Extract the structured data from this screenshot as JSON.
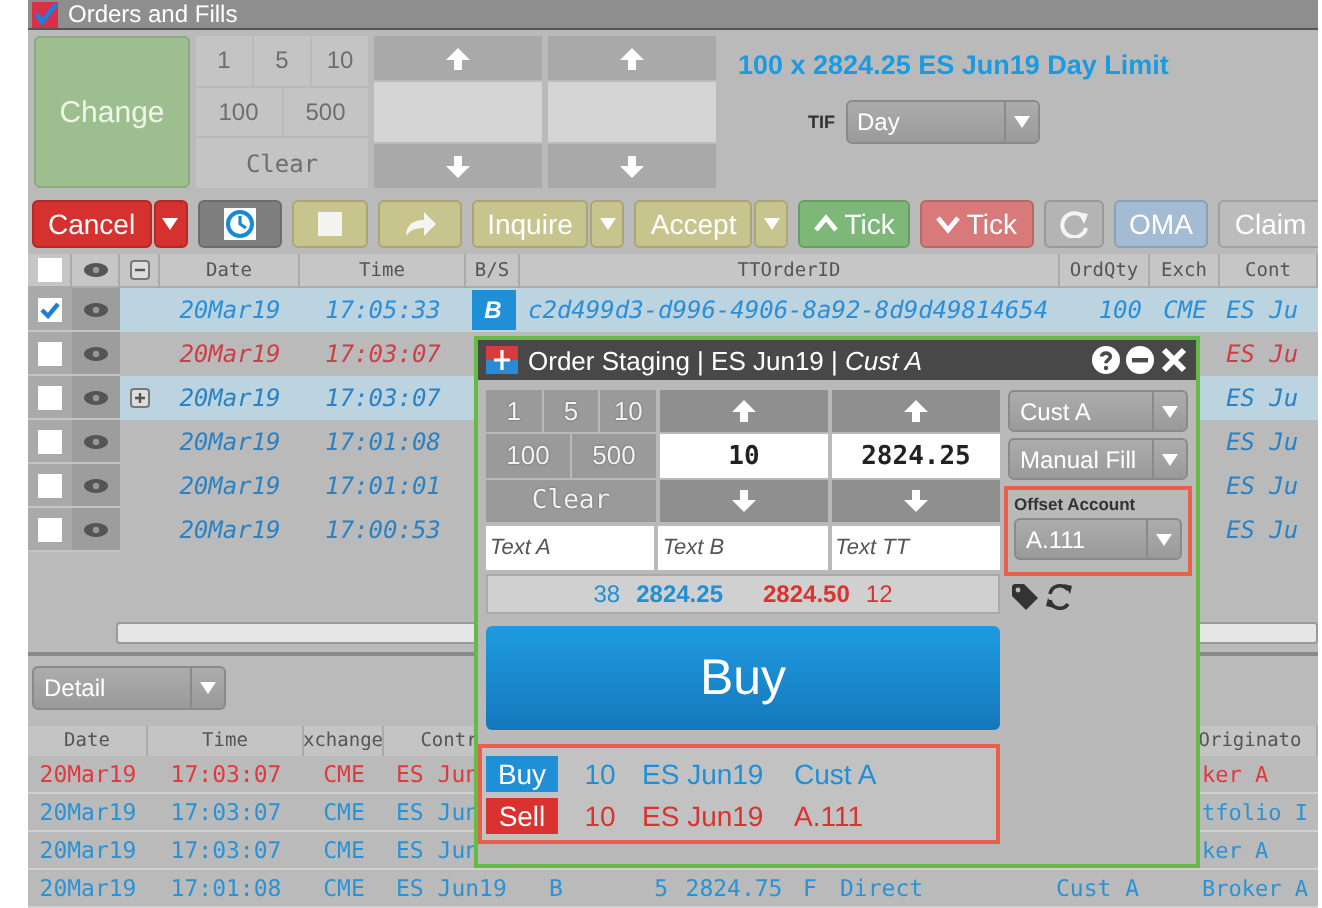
{
  "panel": {
    "title": "Orders and Fills",
    "checked": true
  },
  "order_entry": {
    "change_button": "Change",
    "quantity_buttons": [
      "1",
      "5",
      "10",
      "100",
      "500"
    ],
    "clear_button": "Clear",
    "description": "100 x 2824.25 ES Jun19 Day Limit",
    "tif": {
      "label": "TIF",
      "value": "Day"
    }
  },
  "toolbar": [
    {
      "kind": "button",
      "label": "Cancel",
      "color": "#d4312f",
      "caret": true
    },
    {
      "kind": "history",
      "color": "#7f7f7f"
    },
    {
      "kind": "stop",
      "color": "#c8c48e"
    },
    {
      "kind": "redo",
      "color": "#c8c48e"
    },
    {
      "kind": "button",
      "label": "Inquire",
      "color": "#c8c48e",
      "caret": true
    },
    {
      "kind": "button",
      "label": "Accept",
      "color": "#c8c48e",
      "caret": true
    },
    {
      "kind": "tick-up",
      "label": "Tick",
      "color": "#7db878"
    },
    {
      "kind": "tick-down",
      "label": "Tick",
      "color": "#d87a7a"
    },
    {
      "kind": "refresh",
      "color": "#b4b4b4"
    },
    {
      "kind": "button",
      "label": "OMA",
      "color": "#a4bbd4"
    },
    {
      "kind": "button",
      "label": "Claim",
      "color": "#bcbcbc"
    }
  ],
  "orders_table": {
    "select_all_checked": false,
    "columns": [
      "Date",
      "Time",
      "B/S",
      "TTOrderID",
      "OrdQty",
      "Exch",
      "Cont"
    ],
    "rows": [
      {
        "checked": true,
        "selected": true,
        "expandable": false,
        "color": "#2a8fd8",
        "date": "20Mar19",
        "time": "17:05:33",
        "side": "B",
        "order_id": "c2d499d3-d996-4906-8a92-8d9d49814654",
        "qty": "100",
        "exchange": "CME",
        "contract": "ES Ju"
      },
      {
        "checked": false,
        "selected": false,
        "expandable": false,
        "color": "#cc3f46",
        "date": "20Mar19",
        "time": "17:03:07",
        "contract": "ES Ju"
      },
      {
        "checked": false,
        "selected": true,
        "expandable": true,
        "color": "#2a82c4",
        "date": "20Mar19",
        "time": "17:03:07",
        "contract": "ES Ju"
      },
      {
        "checked": false,
        "selected": false,
        "expandable": false,
        "color": "#2a82c4",
        "date": "20Mar19",
        "time": "17:01:08",
        "contract": "ES Ju"
      },
      {
        "checked": false,
        "selected": false,
        "expandable": false,
        "color": "#2a82c4",
        "date": "20Mar19",
        "time": "17:01:01",
        "contract": "ES Ju"
      },
      {
        "checked": false,
        "selected": false,
        "expandable": false,
        "color": "#2a82c4",
        "date": "20Mar19",
        "time": "17:00:53",
        "contract": "ES Ju"
      }
    ]
  },
  "detail_view": {
    "value": "Detail"
  },
  "fills_table": {
    "columns": [
      "Date",
      "Time",
      "xchange",
      "Contr",
      "Originato"
    ],
    "rows": [
      {
        "color": "#e0393e",
        "date": "20Mar19",
        "time": "17:03:07",
        "exchange": "CME",
        "contract": "ES Jun",
        "originator": "ker A"
      },
      {
        "color": "#2a93d5",
        "date": "20Mar19",
        "time": "17:03:07",
        "exchange": "CME",
        "contract": "ES Jun",
        "originator": "tfolio I"
      },
      {
        "color": "#2a93d5",
        "date": "20Mar19",
        "time": "17:03:07",
        "exchange": "CME",
        "contract": "ES Jun",
        "originator": "ker A"
      },
      {
        "color": "#2a93d5",
        "date": "20Mar19",
        "time": "17:01:08",
        "exchange": "CME",
        "contract": "ES Jun19",
        "side": "B",
        "qty": "5",
        "price": "2824.75",
        "type": "F",
        "route": "Direct",
        "account": "Cust A",
        "originator": "Broker A"
      }
    ]
  },
  "order_staging": {
    "title": "Order Staging | ES Jun19 | *Cust A*",
    "quantity_buttons": [
      "1",
      "5",
      "10",
      "100",
      "500"
    ],
    "clear_button": "Clear",
    "quantity": "10",
    "price": "2824.25",
    "text_fields": [
      {
        "placeholder": "Text A"
      },
      {
        "placeholder": "Text B"
      },
      {
        "placeholder": "Text TT"
      }
    ],
    "market": {
      "bid_qty": "38",
      "bid": "2824.25",
      "ask": "2824.50",
      "ask_qty": "12"
    },
    "buy_button": "Buy",
    "account": "Cust A",
    "fill_type": "Manual Fill",
    "offset_account": {
      "label": "Offset Account",
      "value": "A.111"
    },
    "summary": [
      {
        "side": "Buy",
        "color": "#1f8fd6",
        "qty": "10",
        "contract": "ES Jun19",
        "account": "Cust A"
      },
      {
        "side": "Sell",
        "color": "#d9322f",
        "qty": "10",
        "contract": "ES Jun19",
        "account": "A.111"
      }
    ]
  }
}
